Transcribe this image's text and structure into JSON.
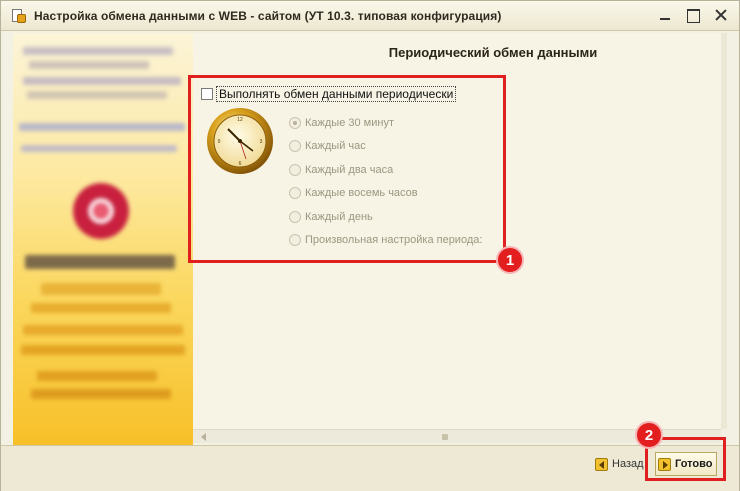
{
  "window": {
    "title": "Настройка обмена данными с WEB - сайтом (УТ 10.3. типовая конфигурация)"
  },
  "main": {
    "page_title": "Периодический обмен данными",
    "periodic_checkbox_label": "Выполнять обмен данными периодически",
    "periodic_checked": false,
    "period_options": [
      {
        "label": "Каждые 30 минут",
        "selected": true,
        "enabled": false
      },
      {
        "label": "Каждый час",
        "selected": false,
        "enabled": false
      },
      {
        "label": "Каждый два часа",
        "selected": false,
        "enabled": false
      },
      {
        "label": "Каждые восемь часов",
        "selected": false,
        "enabled": false
      },
      {
        "label": "Каждый день",
        "selected": false,
        "enabled": false
      },
      {
        "label": "Произвольная настройка периода:",
        "selected": false,
        "enabled": false
      }
    ]
  },
  "footer": {
    "back_label": "Назад",
    "finish_label": "Готово"
  },
  "annotations": {
    "badge_1": "1",
    "badge_2": "2",
    "color": "#e01f1f"
  },
  "icons": {
    "title": "settings-document-icon",
    "clock": "clock-icon",
    "back": "arrow-left-icon",
    "finish": "arrow-right-icon"
  }
}
